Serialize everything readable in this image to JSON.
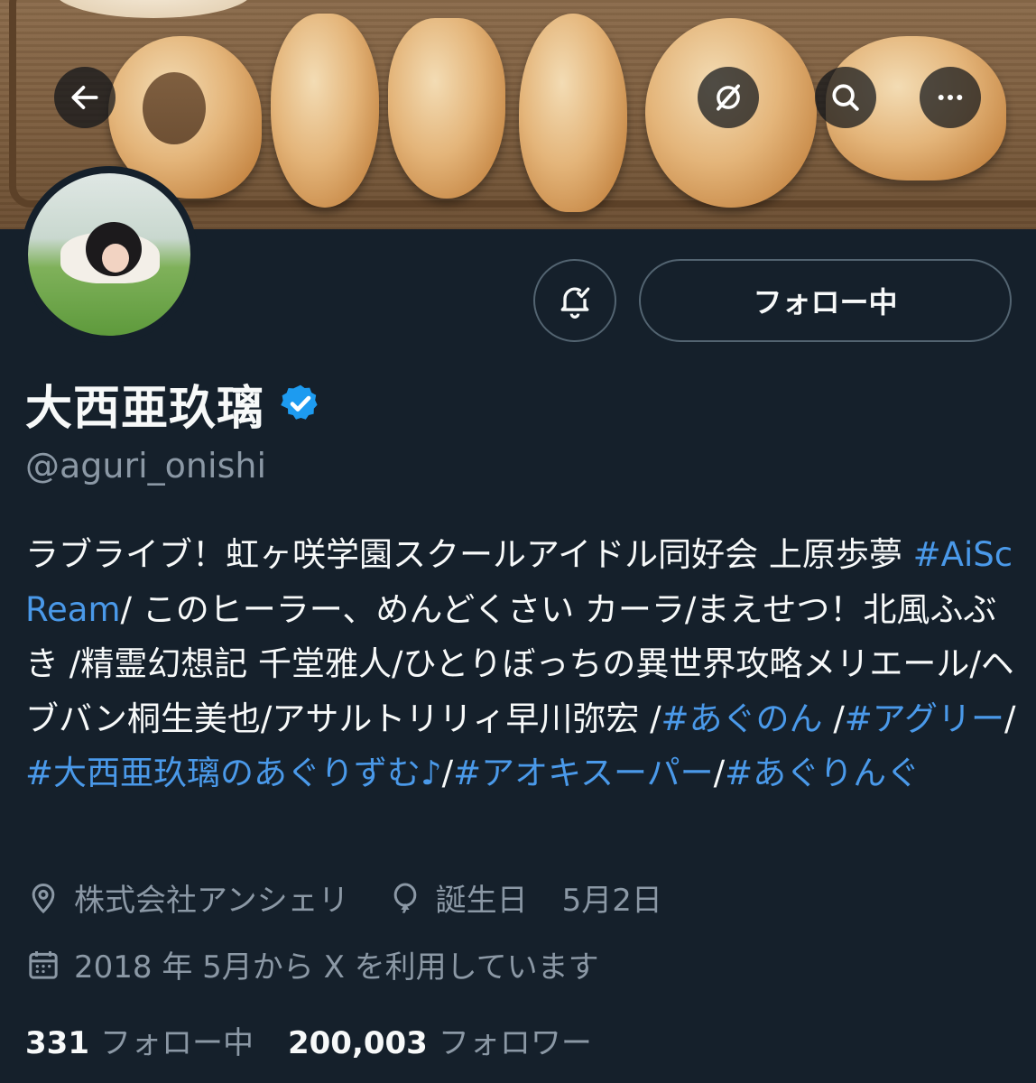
{
  "header": {
    "back_icon": "arrow-left-icon",
    "grok_icon": "grok-icon",
    "search_icon": "search-icon",
    "more_icon": "more-horizontal-icon"
  },
  "profile": {
    "display_name": "大西亜玖璃",
    "verified": true,
    "handle": "@aguri_onishi",
    "follow_button_label": "フォロー中",
    "notification_icon": "bell-check-icon",
    "bio": [
      {
        "t": "text",
        "v": "ラブライブ！虹ヶ咲学園スクールアイドル同好会 上原歩夢 "
      },
      {
        "t": "tag",
        "v": "#AiScReam"
      },
      {
        "t": "text",
        "v": "/ このヒーラー、めんどくさい カーラ/まえせつ！北風ふぶき /精霊幻想記 千堂雅人/ひとりぼっちの異世界攻略メリエール/ヘブバン桐生美也/アサルトリリィ早川弥宏 /"
      },
      {
        "t": "tag",
        "v": "#あぐのん"
      },
      {
        "t": "text",
        "v": " /"
      },
      {
        "t": "tag",
        "v": "#アグリー"
      },
      {
        "t": "text",
        "v": "/"
      },
      {
        "t": "tag",
        "v": "#大西亜玖璃のあぐりずむ♪"
      },
      {
        "t": "text",
        "v": "/"
      },
      {
        "t": "tag",
        "v": "#アオキスーパー"
      },
      {
        "t": "text",
        "v": "/"
      },
      {
        "t": "tag",
        "v": "#あぐりんぐ"
      }
    ],
    "location": "株式会社アンシェリ",
    "birthday_label": "誕生日",
    "birthday_value": "5月2日",
    "joined": "2018 年 5月から X を利用しています",
    "following_count": "331",
    "following_label": "フォロー中",
    "followers_count": "200,003",
    "followers_label": "フォロワー"
  },
  "colors": {
    "background": "#15202b",
    "text": "#f7f9f9",
    "muted": "#8b98a5",
    "link": "#4a99e9",
    "verified": "#1d9bf0",
    "border": "#536471"
  }
}
